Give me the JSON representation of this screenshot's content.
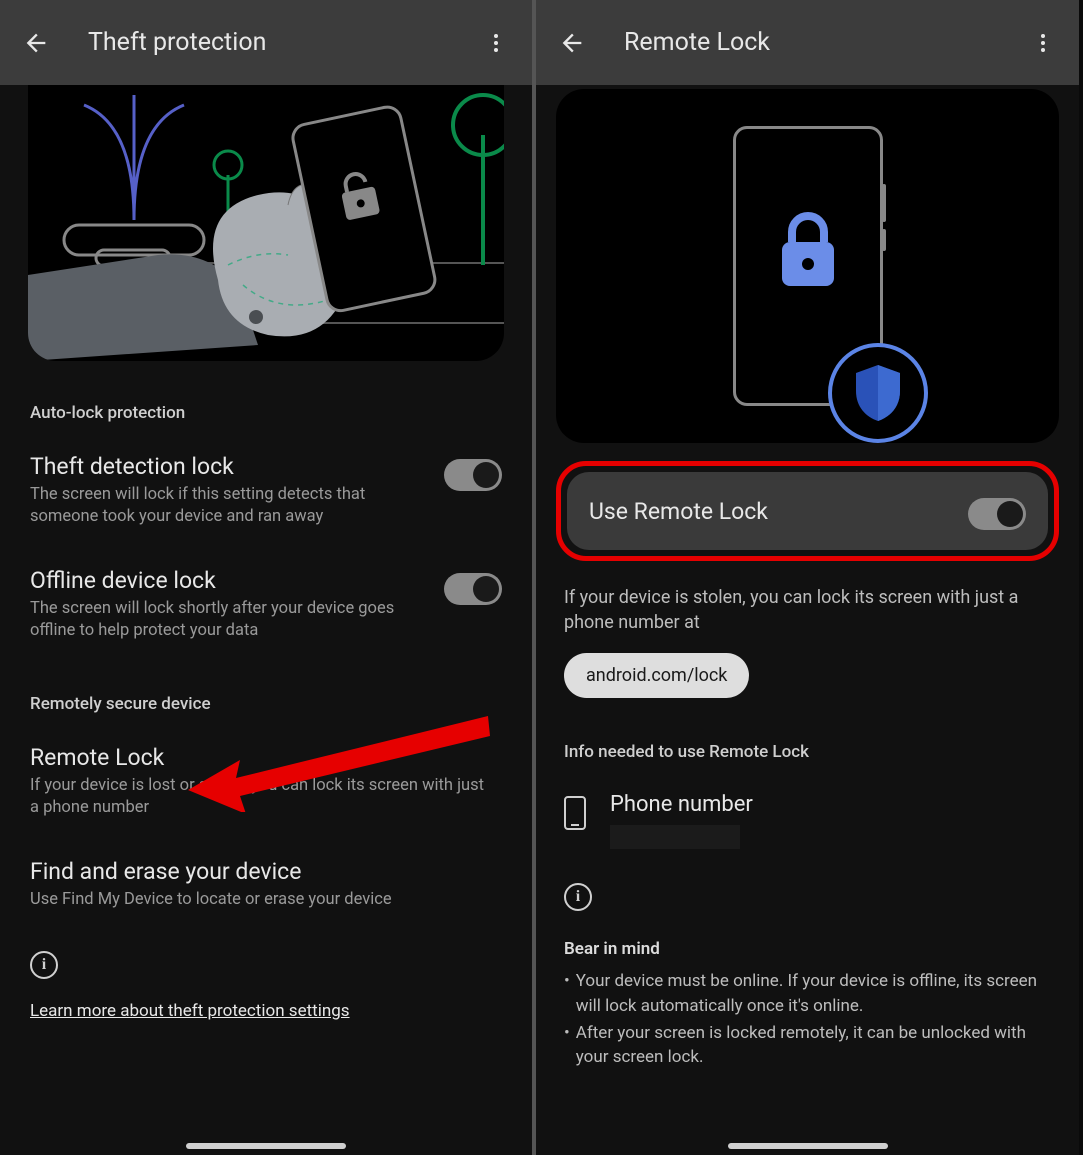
{
  "left": {
    "title": "Theft protection",
    "section_auto": "Auto-lock protection",
    "theft_detection": {
      "title": "Theft detection lock",
      "desc": "The screen will lock if this setting detects that someone took your device and ran away"
    },
    "offline_lock": {
      "title": "Offline device lock",
      "desc": "The screen will lock shortly after your device goes offline to help protect your data"
    },
    "section_remote": "Remotely secure device",
    "remote_lock": {
      "title": "Remote Lock",
      "desc": "If your device is lost or stolen, you can lock its screen with just a phone number"
    },
    "find_erase": {
      "title": "Find and erase your device",
      "desc": "Use Find My Device to locate or erase your device"
    },
    "learn_more": "Learn more about theft protection settings"
  },
  "right": {
    "title": "Remote Lock",
    "use_label": "Use Remote Lock",
    "para": "If your device is stolen, you can lock its screen with just a phone number at",
    "pill": "android.com/lock",
    "info_header": "Info needed to use Remote Lock",
    "phone_label": "Phone number",
    "bear_header": "Bear in mind",
    "bullets": [
      "Your device must be online. If your device is offline, its screen will lock automatically once it's online.",
      "After your screen is locked remotely, it can be unlocked with your screen lock."
    ]
  }
}
